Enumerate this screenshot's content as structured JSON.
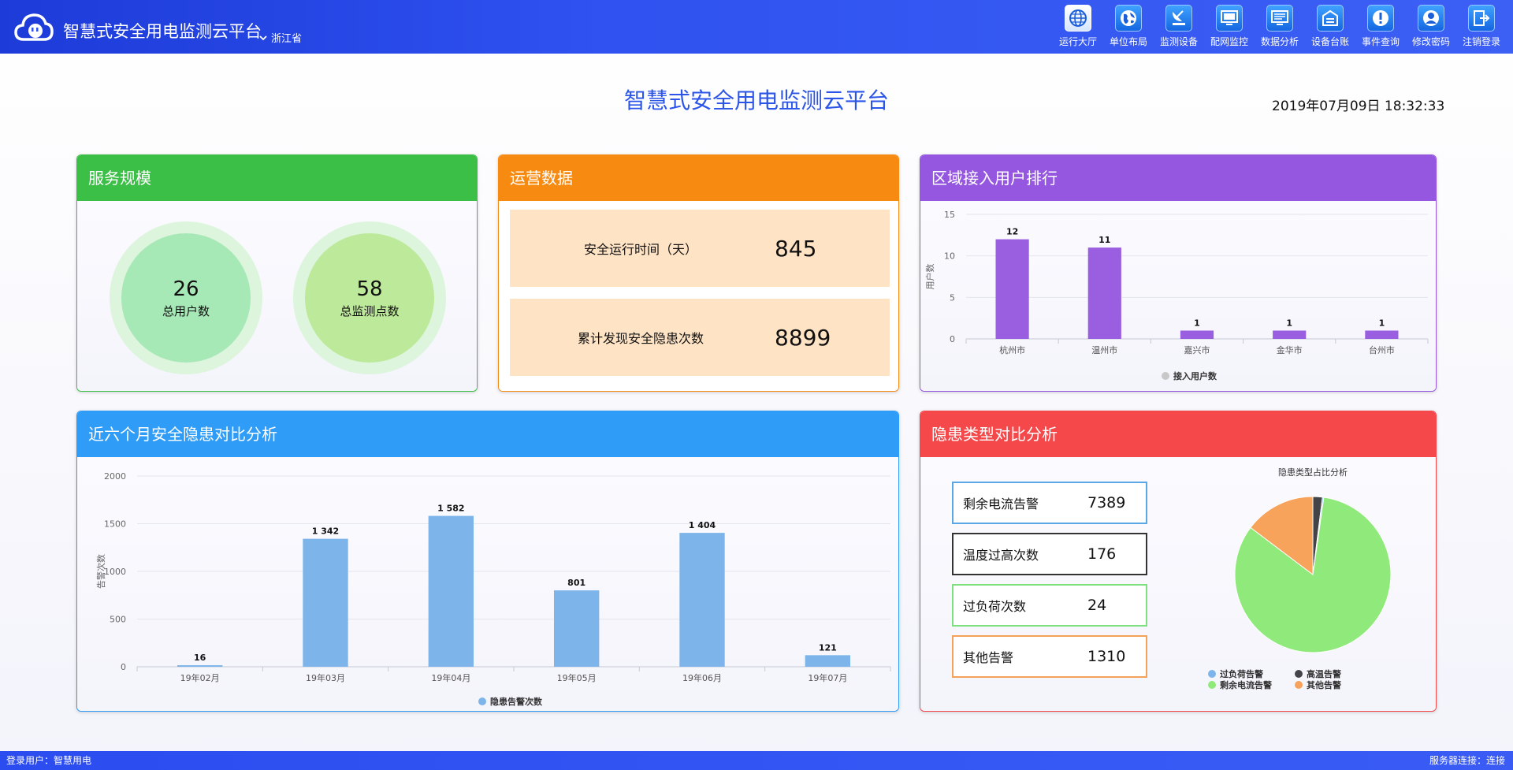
{
  "header": {
    "app_title": "智慧式安全用电监测云平台",
    "region": "浙江省",
    "nav": [
      {
        "label": "运行大厅",
        "icon": "globe-icon"
      },
      {
        "label": "单位布局",
        "icon": "earth-icon"
      },
      {
        "label": "监测设备",
        "icon": "satellite-dish-icon"
      },
      {
        "label": "配网监控",
        "icon": "monitor-icon"
      },
      {
        "label": "数据分析",
        "icon": "screen-chart-icon"
      },
      {
        "label": "设备台账",
        "icon": "ledger-icon"
      },
      {
        "label": "事件查询",
        "icon": "alert-icon"
      },
      {
        "label": "修改密码",
        "icon": "user-icon"
      },
      {
        "label": "注销登录",
        "icon": "logout-icon"
      }
    ]
  },
  "page": {
    "title": "智慧式安全用电监测云平台",
    "datetime": "2019年07月09日 18:32:33"
  },
  "colors": {
    "green": "#3cbf46",
    "orange": "#f78b12",
    "purple": "#9657e0",
    "blue": "#2f9cf8",
    "red": "#f4484a",
    "bar_purple": "#9a5ee0",
    "bar_blue": "#7db4ea"
  },
  "service_scale": {
    "title": "服务规模",
    "items": [
      {
        "value": "26",
        "label": "总用户数"
      },
      {
        "value": "58",
        "label": "总监测点数"
      }
    ]
  },
  "operations": {
    "title": "运营数据",
    "rows": [
      {
        "label": "安全运行时间（天）",
        "value": "845"
      },
      {
        "label": "累计发现安全隐患次数",
        "value": "8899"
      }
    ]
  },
  "region_rank": {
    "title": "区域接入用户排行"
  },
  "monthly": {
    "title": "近六个月安全隐患对比分析"
  },
  "danger_types": {
    "title": "隐患类型对比分析",
    "stats": [
      {
        "label": "剩余电流告警",
        "value": "7389",
        "color": "#5aa7e6"
      },
      {
        "label": "温度过高次数",
        "value": "176",
        "color": "#333333"
      },
      {
        "label": "过负荷次数",
        "value": "24",
        "color": "#7ee07e"
      },
      {
        "label": "其他告警",
        "value": "1310",
        "color": "#f4a15a"
      }
    ]
  },
  "chart_data": [
    {
      "type": "bar",
      "ylabel": "用户数",
      "categories": [
        "杭州市",
        "温州市",
        "嘉兴市",
        "金华市",
        "台州市"
      ],
      "series": [
        {
          "name": "接入用户数",
          "values": [
            12,
            11,
            1,
            1,
            1
          ]
        }
      ],
      "ylim": [
        0,
        15
      ],
      "yticks": [
        0,
        5,
        10,
        15
      ],
      "legend": "bottom",
      "grid": true
    },
    {
      "type": "bar",
      "ylabel": "告警次数",
      "categories": [
        "19年02月",
        "19年03月",
        "19年04月",
        "19年05月",
        "19年06月",
        "19年07月"
      ],
      "series": [
        {
          "name": "隐患告警次数",
          "values": [
            16,
            1342,
            1582,
            801,
            1404,
            121
          ]
        }
      ],
      "data_labels": [
        "16",
        "1 342",
        "1 582",
        "801",
        "1 404",
        "121"
      ],
      "ylim": [
        0,
        2000
      ],
      "yticks": [
        0,
        500,
        1000,
        1500,
        2000
      ],
      "legend": "bottom",
      "grid": true
    },
    {
      "type": "pie",
      "title": "隐患类型占比分析",
      "categories": [
        "剩余电流告警",
        "高温告警",
        "过负荷告警",
        "其他告警"
      ],
      "values": [
        7389,
        176,
        24,
        1310
      ],
      "colors": [
        "#90ea7b",
        "#434348",
        "#7cb5ec",
        "#f7a35c"
      ],
      "legend": [
        "过负荷告警",
        "高温告警",
        "剩余电流告警",
        "其他告警"
      ],
      "legend_colors": [
        "#7cb5ec",
        "#434348",
        "#90ea7b",
        "#f7a35c"
      ]
    }
  ],
  "footer": {
    "login_user": "登录用户：智慧用电",
    "server_status": "服务器连接：连接"
  }
}
